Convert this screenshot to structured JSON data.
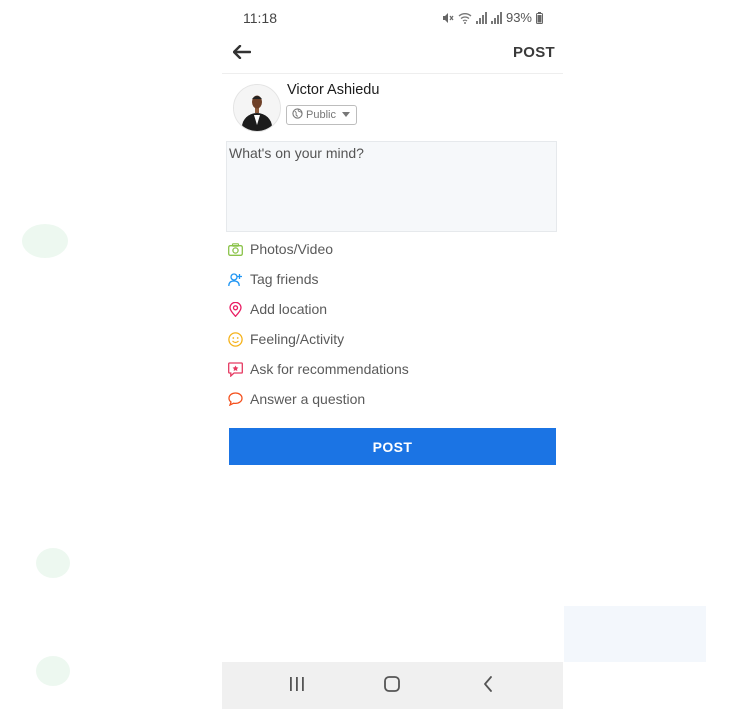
{
  "status_bar": {
    "time": "11:18",
    "battery": "93%"
  },
  "topbar": {
    "back_icon": "arrow-left-icon",
    "post_label": "POST"
  },
  "profile": {
    "name": "Victor Ashiedu",
    "privacy_label": "Public",
    "privacy_icon": "globe-icon"
  },
  "composer": {
    "placeholder": "What's on your mind?"
  },
  "actions": [
    {
      "label": "Photos/Video",
      "icon": "camera-icon",
      "color": "#8bc34a"
    },
    {
      "label": "Tag friends",
      "icon": "tag-person-icon",
      "color": "#2196f3"
    },
    {
      "label": "Add location",
      "icon": "location-pin-icon",
      "color": "#e91e63"
    },
    {
      "label": "Feeling/Activity",
      "icon": "smiley-icon",
      "color": "#f5b21a"
    },
    {
      "label": "Ask for recommendations",
      "icon": "recommendation-icon",
      "color": "#e53961"
    },
    {
      "label": "Answer a question",
      "icon": "speech-bubble-icon",
      "color": "#f4511e"
    }
  ],
  "post_button": {
    "label": "POST",
    "color": "#1b74e4"
  },
  "navbar": {
    "recents_icon": "recents-icon",
    "home_icon": "home-icon",
    "back_icon": "back-chevron-icon"
  }
}
